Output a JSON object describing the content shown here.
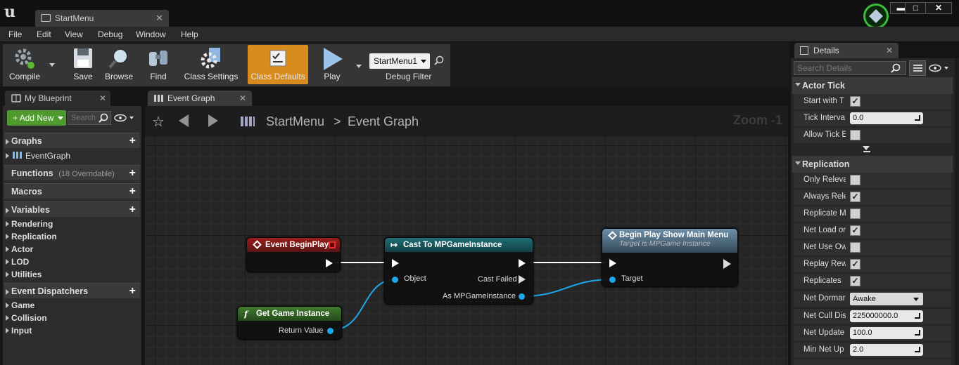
{
  "window": {
    "tab_title": "StartMenu",
    "controls": {
      "minimize": "▬",
      "maximize": "□",
      "close": "✕"
    }
  },
  "menu": {
    "items": [
      "File",
      "Edit",
      "View",
      "Debug",
      "Window",
      "Help"
    ]
  },
  "toolbar": {
    "compile": "Compile",
    "save": "Save",
    "browse": "Browse",
    "find": "Find",
    "class_settings": "Class Settings",
    "class_defaults": "Class Defaults",
    "play": "Play",
    "debug_object": "StartMenu1",
    "debug_filter": "Debug Filter"
  },
  "my_blueprint": {
    "tab": "My Blueprint",
    "add_new": "Add New",
    "search_placeholder": "Search",
    "graphs": "Graphs",
    "graph_item": "EventGraph",
    "functions": "Functions",
    "functions_note": "(18 Overridable)",
    "macros": "Macros",
    "variables": "Variables",
    "variable_categories": [
      "Rendering",
      "Replication",
      "Actor",
      "LOD",
      "Utilities"
    ],
    "event_dispatchers": "Event Dispatchers",
    "dispatcher_categories": [
      "Game",
      "Collision",
      "Input"
    ]
  },
  "graph": {
    "tab": "Event Graph",
    "breadcrumb_root": "StartMenu",
    "breadcrumb_sep": ">",
    "breadcrumb_current": "Event Graph",
    "zoom": "Zoom -1",
    "nodes": {
      "event_begin_play": {
        "title": "Event BeginPlay"
      },
      "cast": {
        "title": "Cast To MPGameInstance",
        "object_pin": "Object",
        "cast_failed_pin": "Cast Failed",
        "as_pin": "As MPGameInstance"
      },
      "begin_play_menu": {
        "title": "Begin Play Show Main Menu",
        "subtitle": "Target is MPGame Instance",
        "target_pin": "Target"
      },
      "get_game_instance": {
        "title": "Get Game Instance",
        "return_pin": "Return Value"
      }
    }
  },
  "details": {
    "tab": "Details",
    "search_placeholder": "Search Details",
    "actor_tick": {
      "title": "Actor Tick",
      "start_with_tick": {
        "label": "Start with T",
        "checked": true
      },
      "tick_interval": {
        "label": "Tick Interva",
        "value": "0.0"
      },
      "allow_tick": {
        "label": "Allow Tick E",
        "checked": false
      }
    },
    "replication": {
      "title": "Replication",
      "rows": [
        {
          "label": "Only Releva",
          "checked": false
        },
        {
          "label": "Always Rele",
          "checked": true
        },
        {
          "label": "Replicate M",
          "checked": false
        },
        {
          "label": "Net Load or",
          "checked": true
        },
        {
          "label": "Net Use Ow",
          "checked": false
        },
        {
          "label": "Replay Rew",
          "checked": true
        },
        {
          "label": "Replicates",
          "checked": true
        }
      ],
      "net_dormancy": {
        "label": "Net Dormar",
        "value": "Awake"
      },
      "net_cull": {
        "label": "Net Cull Dis",
        "value": "225000000.0"
      },
      "net_update": {
        "label": "Net Update",
        "value": "100.0"
      },
      "min_net_update": {
        "label": "Min Net Up",
        "value": "2.0"
      }
    }
  }
}
